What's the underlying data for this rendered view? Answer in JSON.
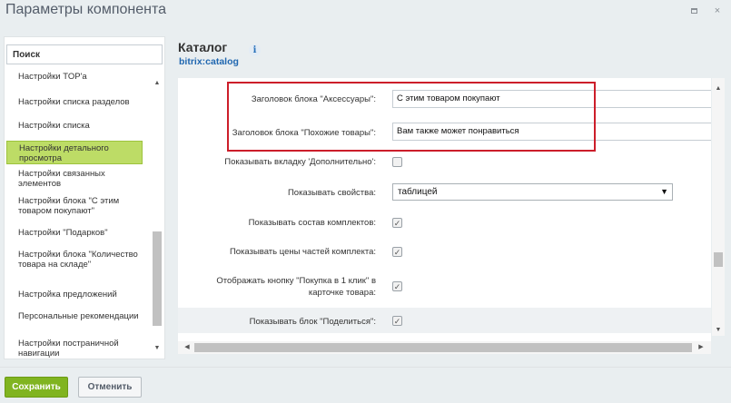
{
  "window": {
    "title": "Параметры компонента",
    "maximize_icon": "maximize-icon",
    "close_icon": "close-icon",
    "close_glyph": "×"
  },
  "sidebar": {
    "search_placeholder": "Поиск",
    "items": [
      {
        "label": "Настройки TOP'а"
      },
      {
        "label": "Настройки списка разделов"
      },
      {
        "label": "Настройки списка"
      },
      {
        "label": "Настройки детального просмотра",
        "active": true
      },
      {
        "label": "Настройки связанных элементов"
      },
      {
        "label": "Настройки блока \"С этим товаром покупают\""
      },
      {
        "label": "Настройки \"Подарков\""
      },
      {
        "label": "Настройки блока \"Количество товара на складе\""
      },
      {
        "label": "Настройка предложений"
      },
      {
        "label": "Персональные рекомендации"
      },
      {
        "label": "Настройки постраничной навигации"
      }
    ]
  },
  "content": {
    "title": "Каталог",
    "subtitle": "bitrix:catalog",
    "info_icon": "info-icon",
    "rows": [
      {
        "label": "Заголовок блока \"Аксессуары\":",
        "value": "С этим товаром покупают",
        "type": "text"
      },
      {
        "label": "Заголовок блока \"Похожие товары\":",
        "value": "Вам также может понравиться",
        "type": "text"
      },
      {
        "label": "Показывать вкладку 'Дополнительно':",
        "checked": false,
        "type": "checkbox"
      },
      {
        "label": "Показывать свойства:",
        "value": "таблицей",
        "type": "select"
      },
      {
        "label": "Показывать состав комплектов:",
        "checked": true,
        "type": "checkbox"
      },
      {
        "label": "Показывать цены частей комплекта:",
        "checked": true,
        "type": "checkbox"
      },
      {
        "label": "Отображать кнопку \"Покупка в 1 клик\" в карточке товара:",
        "checked": true,
        "type": "checkbox"
      },
      {
        "label": "Показывать блок \"Поделиться\":",
        "checked": true,
        "type": "checkbox"
      }
    ]
  },
  "footer": {
    "save_label": "Сохранить",
    "cancel_label": "Отменить"
  },
  "colors": {
    "accent_green": "#80b420",
    "active_item": "#bddc66",
    "highlight_red": "#cc1e2a",
    "link_blue": "#2067b0"
  }
}
